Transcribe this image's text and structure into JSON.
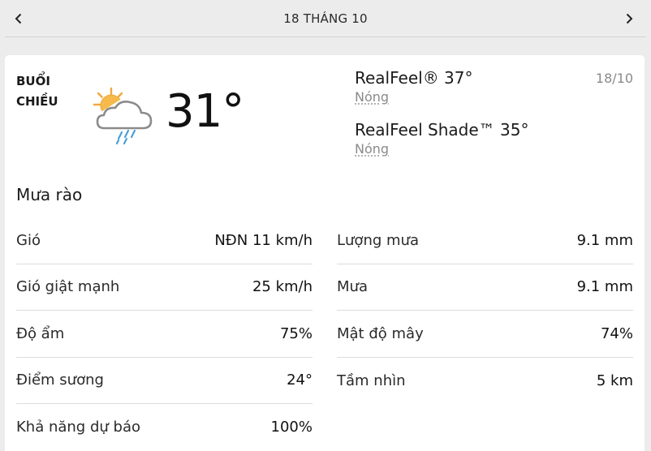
{
  "header": {
    "date_title": "18 THÁNG 10",
    "prev_icon": "chevron-left-icon",
    "next_icon": "chevron-right-icon"
  },
  "card": {
    "period_line1": "BUỔI",
    "period_line2": "CHIỀU",
    "icon": "partly-sunny-showers-icon",
    "temperature": "31°",
    "realfeel": {
      "label": "RealFeel® 37°",
      "sub": "Nóng"
    },
    "realfeel_shade": {
      "label": "RealFeel Shade™ 35°",
      "sub": "Nóng"
    },
    "date_short": "18/10",
    "phrase": "Mưa rào"
  },
  "details": {
    "left": [
      {
        "label": "Gió",
        "value": "NĐN 11 km/h"
      },
      {
        "label": "Gió giật mạnh",
        "value": "25 km/h"
      },
      {
        "label": "Độ ẩm",
        "value": "75%"
      },
      {
        "label": "Điểm sương",
        "value": "24°"
      },
      {
        "label": "Khả năng dự báo",
        "value": "100%"
      }
    ],
    "right": [
      {
        "label": "Lượng mưa",
        "value": "9.1 mm"
      },
      {
        "label": "Mưa",
        "value": "9.1 mm"
      },
      {
        "label": "Mật độ mây",
        "value": "74%"
      },
      {
        "label": "Tầm nhìn",
        "value": "5 km"
      }
    ]
  },
  "colors": {
    "sun": "#f2a83b",
    "cloud_outline": "#8b8b8b",
    "rain": "#4a9fd8"
  }
}
